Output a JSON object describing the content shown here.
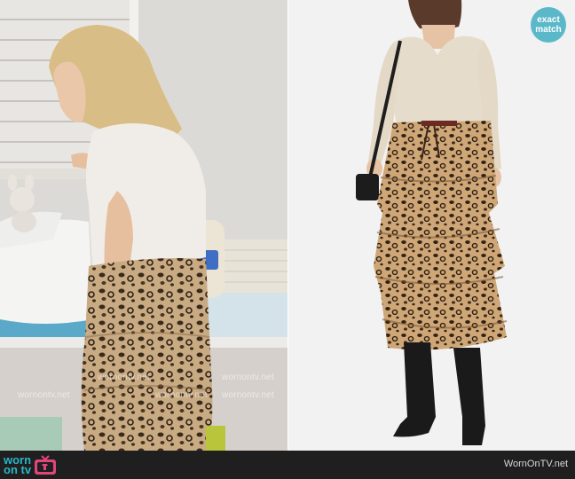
{
  "badge": {
    "line1": "exact",
    "line2": "match",
    "color": "#5bb8c9"
  },
  "watermark_text": "wornontv.net",
  "footer": {
    "logo_line1": "worn",
    "logo_line2": "on tv",
    "logo_color": "#2ab6c8",
    "logo_icon": "tv-icon",
    "site_text": "WornOnTV.net",
    "background": "#1f1f1f"
  }
}
